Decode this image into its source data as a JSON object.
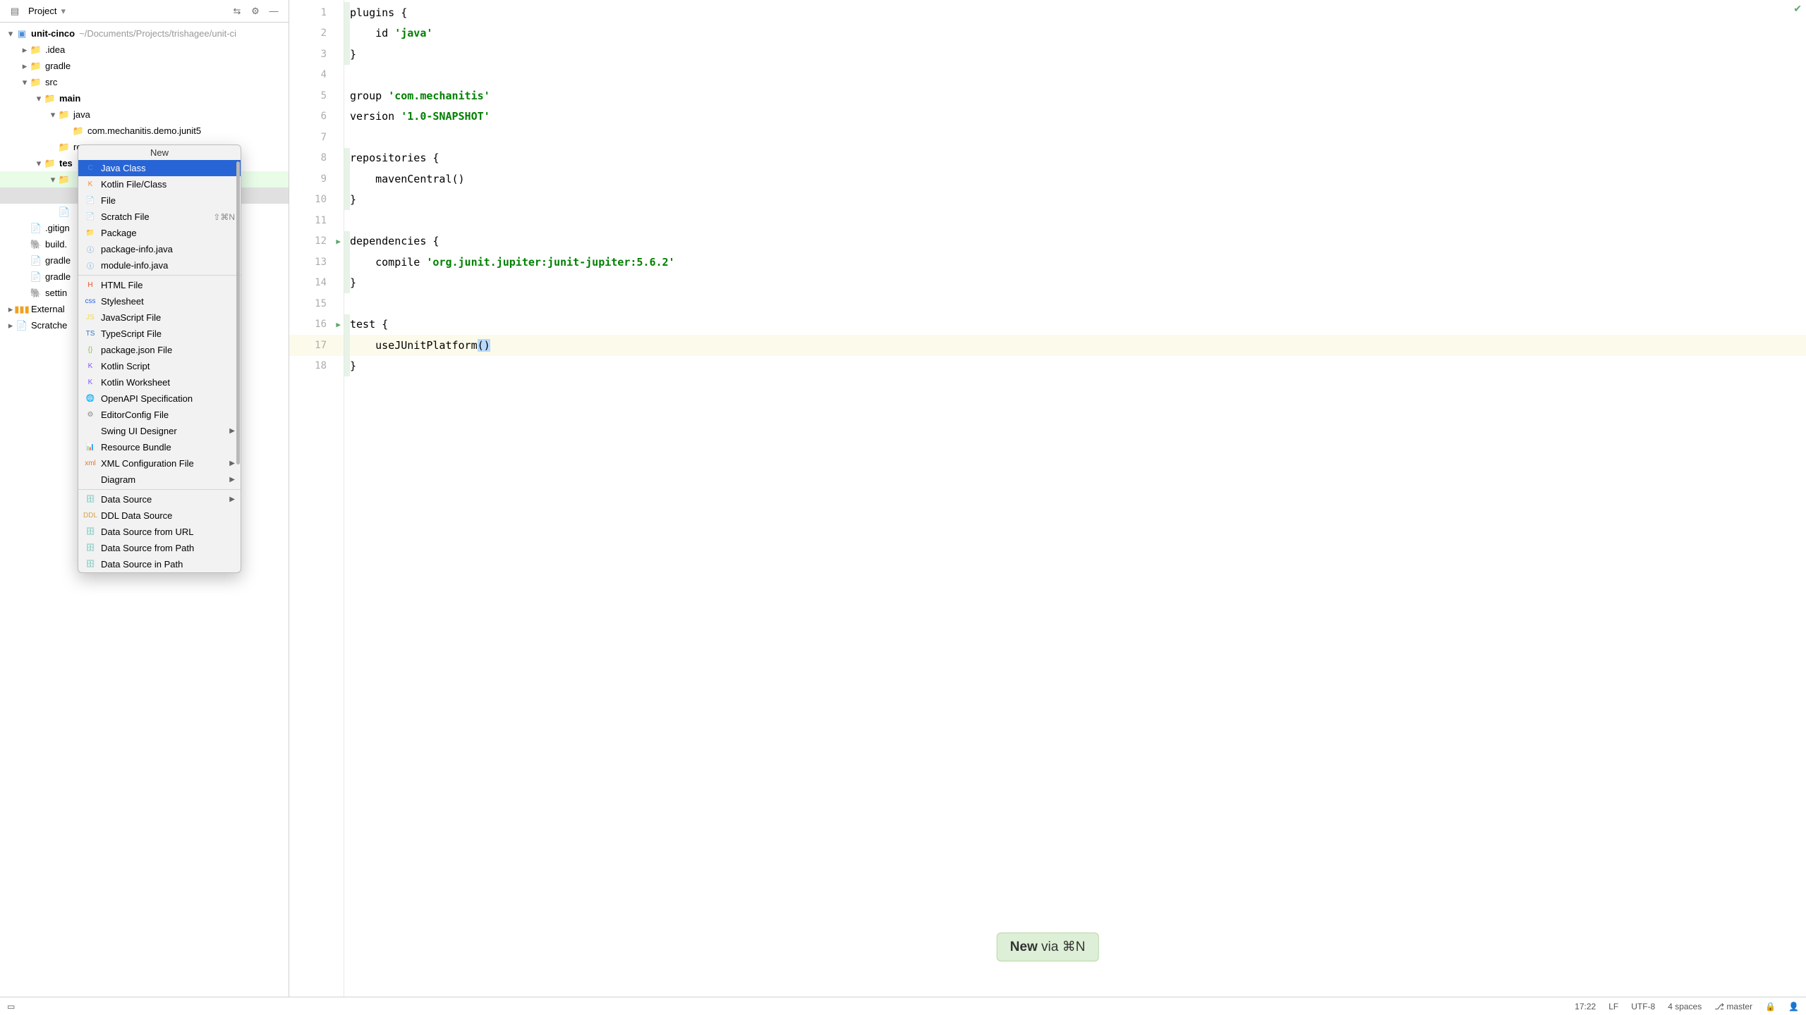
{
  "project_header": {
    "title": "Project"
  },
  "tree": {
    "root": {
      "label": "unit-cinco",
      "path": "~/Documents/Projects/trishagee/unit-ci"
    },
    "idea": ".idea",
    "gradle": "gradle",
    "src": "src",
    "main": "main",
    "java": "java",
    "pkg": "com.mechanitis.demo.junit5",
    "resources": "resources",
    "test": "tes",
    "gitignore": ".gitign",
    "build": "build.",
    "gradleprops": "gradle",
    "gradlew": "gradle",
    "settin": "settin",
    "external": "External",
    "scratches": "Scratche"
  },
  "context_menu": {
    "title": "New",
    "items": [
      {
        "label": "Java Class",
        "icon": "C",
        "iconcolor": "#4a90d9",
        "selected": true
      },
      {
        "label": "Kotlin File/Class",
        "icon": "K",
        "iconcolor": "#f28c38"
      },
      {
        "label": "File",
        "icon": "📄"
      },
      {
        "label": "Scratch File",
        "icon": "📄",
        "shortcut": "⇧⌘N"
      },
      {
        "label": "Package",
        "icon": "📁"
      },
      {
        "label": "package-info.java",
        "icon": "ⓘ",
        "iconcolor": "#4a90d9"
      },
      {
        "label": "module-info.java",
        "icon": "ⓘ",
        "iconcolor": "#4a90d9"
      },
      {
        "sep": true
      },
      {
        "label": "HTML File",
        "icon": "H",
        "iconcolor": "#e44d26"
      },
      {
        "label": "Stylesheet",
        "icon": "css",
        "iconcolor": "#2965f1"
      },
      {
        "label": "JavaScript File",
        "icon": "JS",
        "iconcolor": "#f0db4f"
      },
      {
        "label": "TypeScript File",
        "icon": "TS",
        "iconcolor": "#3178c6"
      },
      {
        "label": "package.json File",
        "icon": "{}",
        "iconcolor": "#8bc34a"
      },
      {
        "label": "Kotlin Script",
        "icon": "K",
        "iconcolor": "#7f52ff"
      },
      {
        "label": "Kotlin Worksheet",
        "icon": "K",
        "iconcolor": "#7f52ff"
      },
      {
        "label": "OpenAPI Specification",
        "icon": "🌐",
        "iconcolor": "#6bb33f"
      },
      {
        "label": "EditorConfig File",
        "icon": "⚙",
        "iconcolor": "#888"
      },
      {
        "label": "Swing UI Designer",
        "submenu": true
      },
      {
        "label": "Resource Bundle",
        "icon": "📊"
      },
      {
        "label": "XML Configuration File",
        "icon": "xml",
        "iconcolor": "#e8762d",
        "submenu": true
      },
      {
        "label": "Diagram",
        "submenu": true
      },
      {
        "sep": true
      },
      {
        "label": "Data Source",
        "icon": "🗄",
        "iconcolor": "#4fb8af",
        "submenu": true
      },
      {
        "label": "DDL Data Source",
        "icon": "DDL",
        "iconcolor": "#d9a34a"
      },
      {
        "label": "Data Source from URL",
        "icon": "🗄",
        "iconcolor": "#4fb8af"
      },
      {
        "label": "Data Source from Path",
        "icon": "🗄",
        "iconcolor": "#4fb8af"
      },
      {
        "label": "Data Source in Path",
        "icon": "🗄",
        "iconcolor": "#4fb8af"
      }
    ]
  },
  "editor": {
    "lines": [
      [
        {
          "t": "plugins ",
          "c": "plain"
        },
        {
          "t": "{",
          "c": "plain"
        }
      ],
      [
        {
          "t": "    id ",
          "c": "plain"
        },
        {
          "t": "'java'",
          "c": "str"
        }
      ],
      [
        {
          "t": "}",
          "c": "plain"
        }
      ],
      [],
      [
        {
          "t": "group ",
          "c": "plain"
        },
        {
          "t": "'com.mechanitis'",
          "c": "str"
        }
      ],
      [
        {
          "t": "version ",
          "c": "plain"
        },
        {
          "t": "'1.0-SNAPSHOT'",
          "c": "str"
        }
      ],
      [],
      [
        {
          "t": "repositories {",
          "c": "plain"
        }
      ],
      [
        {
          "t": "    mavenCentral()",
          "c": "plain"
        }
      ],
      [
        {
          "t": "}",
          "c": "plain"
        }
      ],
      [],
      [
        {
          "t": "dependencies {",
          "c": "plain"
        }
      ],
      [
        {
          "t": "    compile ",
          "c": "plain"
        },
        {
          "t": "'org.junit.jupiter:junit-jupiter:5.6.2'",
          "c": "str"
        }
      ],
      [
        {
          "t": "}",
          "c": "plain"
        }
      ],
      [],
      [
        {
          "t": "test {",
          "c": "plain"
        }
      ],
      [
        {
          "t": "    useJUnitPlatform",
          "c": "plain"
        },
        {
          "t": "()",
          "c": "plain",
          "sel": true
        }
      ],
      [
        {
          "t": "}",
          "c": "plain"
        }
      ]
    ],
    "runnable_lines": [
      12,
      16
    ],
    "highlighted_line": 17
  },
  "toast": {
    "bold": "New",
    "rest": " via ⌘N"
  },
  "statusbar": {
    "pos": "17:22",
    "lf": "LF",
    "enc": "UTF-8",
    "indent": "4 spaces",
    "branch": "master"
  }
}
